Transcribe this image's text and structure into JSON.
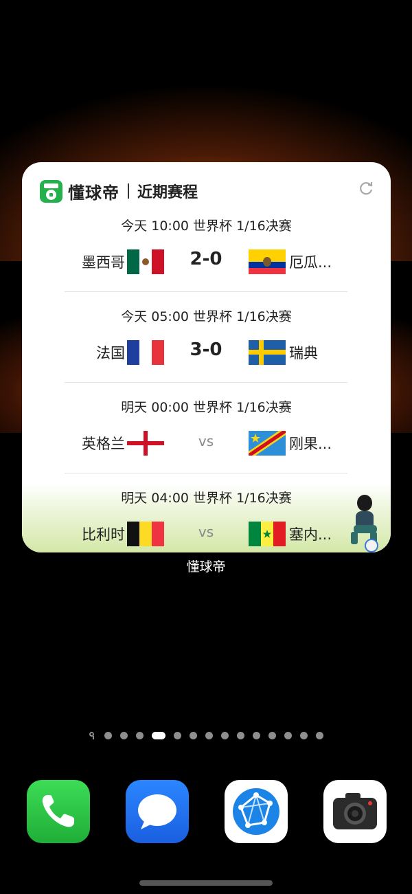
{
  "widget": {
    "brand": "懂球帝",
    "title": "近期赛程",
    "refresh_icon": "refresh-icon"
  },
  "matches": [
    {
      "meta": "今天 10:00 世界杯 1/16决赛",
      "home": "墨西哥",
      "home_flag": "mexico-flag",
      "result": "2-0",
      "away": "厄瓜...",
      "away_flag": "ecuador-flag"
    },
    {
      "meta": "今天 05:00 世界杯 1/16决赛",
      "home": "法国",
      "home_flag": "france-flag",
      "result": "3-0",
      "away": "瑞典",
      "away_flag": "sweden-flag"
    },
    {
      "meta": "明天 00:00 世界杯 1/16决赛",
      "home": "英格兰",
      "home_flag": "england-flag",
      "result": "vs",
      "away": "刚果...",
      "away_flag": "dr-congo-flag"
    },
    {
      "meta": "明天 04:00 世界杯 1/16决赛",
      "home": "比利时",
      "home_flag": "belgium-flag",
      "result": "vs",
      "away": "塞内...",
      "away_flag": "senegal-flag"
    }
  ],
  "widget_label": "懂球帝",
  "page_dots": {
    "count": 15,
    "active_index": 4
  },
  "dock": [
    {
      "name": "phone-app-icon"
    },
    {
      "name": "messages-app-icon"
    },
    {
      "name": "browser-app-icon"
    },
    {
      "name": "camera-app-icon"
    }
  ],
  "colors": {
    "logo_green": "#22b14c",
    "phone_green": "#24c33e",
    "messages_blue": "#1e6ef0",
    "browser_blue": "#1b84e6"
  }
}
